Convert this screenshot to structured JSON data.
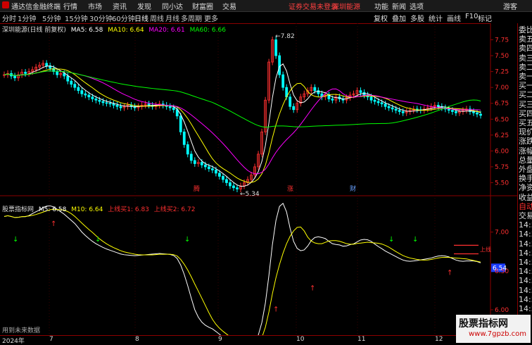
{
  "window": {
    "app_name": "通达信金融终端",
    "menus": [
      "行情",
      "市场",
      "资讯",
      "发现",
      "同小达",
      "财富圈",
      "交易"
    ],
    "notice": "证券交易未登录",
    "stock_tag": "深圳能源",
    "right_menus": [
      "功能",
      "新闻",
      "选项",
      "游客"
    ]
  },
  "periods": [
    "分时",
    "1分钟",
    "5分钟",
    "15分钟",
    "30分钟",
    "60分钟",
    "日线",
    "周线",
    "月线",
    "多周期",
    "更多"
  ],
  "active_period": "日线",
  "tools": [
    "复权",
    "叠加",
    "多股",
    "统计",
    "画线",
    "F10",
    "标记"
  ],
  "main_chart": {
    "title": "深圳能源(日线 前复权)",
    "legend": [
      {
        "label": "MA5: 6.58",
        "color": "#ffffff"
      },
      {
        "label": "MA10: 6.64",
        "color": "#ffff00"
      },
      {
        "label": "MA20: 6.61",
        "color": "#ff00ff"
      },
      {
        "label": "MA60: 6.66",
        "color": "#00ff00"
      }
    ],
    "y_ticks": [
      "7.75",
      "7.50",
      "7.25",
      "7.00",
      "6.75",
      "6.50",
      "6.25",
      "6.00",
      "5.75",
      "5.50"
    ],
    "high_label": "7.82",
    "low_label": "5.34",
    "markers": [
      "腾",
      "涨",
      "财"
    ]
  },
  "sub_chart": {
    "title": "股票指标网",
    "legend": [
      {
        "label": "M5: 6.58",
        "color": "#ffffff"
      },
      {
        "label": "M10: 6.64",
        "color": "#ffff00"
      },
      {
        "label": "上线买1: 6.83",
        "color": "#ff3030"
      },
      {
        "label": "上线买2: 6.72",
        "color": "#ff3030"
      }
    ],
    "y_ticks": [
      "7.00",
      "6.50",
      "6.00"
    ],
    "current_value": "6.54",
    "signal_label": "上线",
    "footer_note": "用到未来数据"
  },
  "right_panel": {
    "labels": [
      "委比",
      "卖五",
      "卖四",
      "卖三",
      "卖二",
      "卖一",
      "买一",
      "买二",
      "买三",
      "买四",
      "买五",
      "现价",
      "涨跌",
      "涨幅",
      "总量",
      "外盘",
      "换手",
      "净资",
      "收益",
      "自动",
      "交易",
      "14:5",
      "14:5",
      "14:5",
      "14:5",
      "14:5",
      "14:5",
      "14:5",
      "14:5",
      "14:5",
      "14:5"
    ]
  },
  "date_axis": [
    "2024年",
    "7",
    "8",
    "9",
    "10",
    "11",
    "12"
  ],
  "watermark": {
    "line1": "股票指标网",
    "line2": "www.7gpzb.com"
  },
  "colors": {
    "up": "#ff3030",
    "down": "#00ffff",
    "ma5": "#ffffff",
    "ma10": "#ffff00",
    "ma20": "#ff00ff",
    "ma60": "#00ff00",
    "grid": "#8b0000"
  },
  "chart_data": {
    "type": "candlestick",
    "x": [
      1,
      2,
      3,
      4,
      5,
      6,
      7,
      8,
      9,
      10,
      11,
      12,
      13,
      14,
      15,
      16,
      17,
      18,
      19,
      20,
      21,
      22,
      23,
      24,
      25,
      26,
      27,
      28,
      29,
      30,
      31,
      32,
      33,
      34,
      35,
      36,
      37,
      38,
      39,
      40,
      41,
      42,
      43,
      44,
      45,
      46,
      47,
      48,
      49,
      50,
      51,
      52,
      53,
      54,
      55,
      56,
      57,
      58,
      59,
      60,
      61,
      62,
      63,
      64,
      65,
      66,
      67,
      68,
      69,
      70,
      71,
      72,
      73,
      74,
      75,
      76,
      77,
      78,
      79,
      80,
      81,
      82,
      83,
      84,
      85,
      86,
      87,
      88,
      89,
      90,
      91,
      92,
      93,
      94,
      95,
      96,
      97,
      98,
      99,
      100,
      101,
      102,
      103,
      104,
      105,
      106,
      107,
      108,
      109,
      110,
      111,
      112,
      113,
      114,
      115,
      116,
      117,
      118,
      119,
      120,
      121,
      122,
      123,
      124,
      125,
      126,
      127,
      128,
      129,
      130,
      131,
      132,
      133,
      134,
      135,
      136
    ],
    "close": [
      7.2,
      7.22,
      7.18,
      7.15,
      7.2,
      7.24,
      7.22,
      7.25,
      7.28,
      7.32,
      7.35,
      7.38,
      7.34,
      7.3,
      7.25,
      7.2,
      7.22,
      7.18,
      7.1,
      7.05,
      7.0,
      6.95,
      6.9,
      6.88,
      6.85,
      6.82,
      6.8,
      6.78,
      6.76,
      6.75,
      6.74,
      6.72,
      6.7,
      6.68,
      6.7,
      6.72,
      6.7,
      6.68,
      6.7,
      6.72,
      6.74,
      6.72,
      6.7,
      6.72,
      6.74,
      6.72,
      6.7,
      6.68,
      6.65,
      6.55,
      6.3,
      6.1,
      5.95,
      5.85,
      5.8,
      5.82,
      5.78,
      5.75,
      5.72,
      5.7,
      5.65,
      5.6,
      5.55,
      5.5,
      5.45,
      5.42,
      5.4,
      5.45,
      5.5,
      5.55,
      5.62,
      5.75,
      5.95,
      6.3,
      6.8,
      7.4,
      7.75,
      7.5,
      7.2,
      7.0,
      6.85,
      6.7,
      6.65,
      6.75,
      6.85,
      6.9,
      6.95,
      7.0,
      6.95,
      6.9,
      6.85,
      6.88,
      6.82,
      6.8,
      6.85,
      6.82,
      6.8,
      6.84,
      6.88,
      6.9,
      6.95,
      6.92,
      6.88,
      6.85,
      6.8,
      6.78,
      6.76,
      6.74,
      6.7,
      6.68,
      6.66,
      6.64,
      6.62,
      6.6,
      6.62,
      6.64,
      6.66,
      6.65,
      6.64,
      6.66,
      6.68,
      6.7,
      6.72,
      6.7,
      6.68,
      6.66,
      6.64,
      6.62,
      6.6,
      6.62,
      6.64,
      6.66,
      6.62,
      6.6,
      6.58,
      6.56
    ],
    "high_point": 7.82,
    "low_point": 5.34,
    "ylim": [
      5.35,
      7.9
    ]
  }
}
